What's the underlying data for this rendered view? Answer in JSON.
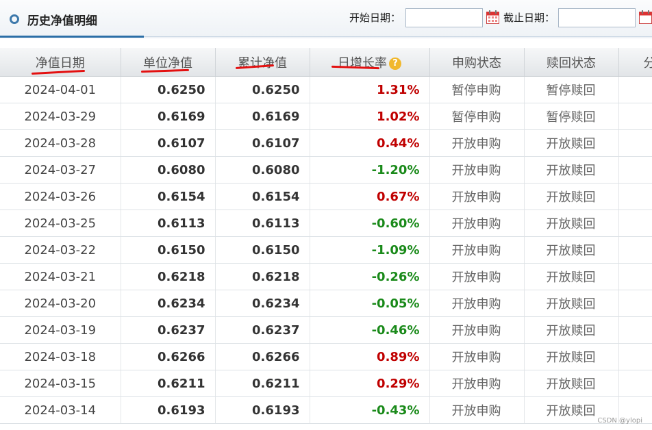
{
  "header": {
    "title": "历史净值明细",
    "start_label": "开始日期：",
    "end_label": "截止日期：",
    "start_value": "",
    "end_value": ""
  },
  "table": {
    "columns": [
      "净值日期",
      "单位净值",
      "累计净值",
      "日增长率",
      "申购状态",
      "赎回状态",
      "分"
    ],
    "rows": [
      {
        "date": "2024-04-01",
        "nav": "0.6250",
        "acc": "0.6250",
        "rate": "1.31%",
        "buy": "暂停申购",
        "sell": "暂停赎回"
      },
      {
        "date": "2024-03-29",
        "nav": "0.6169",
        "acc": "0.6169",
        "rate": "1.02%",
        "buy": "暂停申购",
        "sell": "暂停赎回"
      },
      {
        "date": "2024-03-28",
        "nav": "0.6107",
        "acc": "0.6107",
        "rate": "0.44%",
        "buy": "开放申购",
        "sell": "开放赎回"
      },
      {
        "date": "2024-03-27",
        "nav": "0.6080",
        "acc": "0.6080",
        "rate": "-1.20%",
        "buy": "开放申购",
        "sell": "开放赎回"
      },
      {
        "date": "2024-03-26",
        "nav": "0.6154",
        "acc": "0.6154",
        "rate": "0.67%",
        "buy": "开放申购",
        "sell": "开放赎回"
      },
      {
        "date": "2024-03-25",
        "nav": "0.6113",
        "acc": "0.6113",
        "rate": "-0.60%",
        "buy": "开放申购",
        "sell": "开放赎回"
      },
      {
        "date": "2024-03-22",
        "nav": "0.6150",
        "acc": "0.6150",
        "rate": "-1.09%",
        "buy": "开放申购",
        "sell": "开放赎回"
      },
      {
        "date": "2024-03-21",
        "nav": "0.6218",
        "acc": "0.6218",
        "rate": "-0.26%",
        "buy": "开放申购",
        "sell": "开放赎回"
      },
      {
        "date": "2024-03-20",
        "nav": "0.6234",
        "acc": "0.6234",
        "rate": "-0.05%",
        "buy": "开放申购",
        "sell": "开放赎回"
      },
      {
        "date": "2024-03-19",
        "nav": "0.6237",
        "acc": "0.6237",
        "rate": "-0.46%",
        "buy": "开放申购",
        "sell": "开放赎回"
      },
      {
        "date": "2024-03-18",
        "nav": "0.6266",
        "acc": "0.6266",
        "rate": "0.89%",
        "buy": "开放申购",
        "sell": "开放赎回"
      },
      {
        "date": "2024-03-15",
        "nav": "0.6211",
        "acc": "0.6211",
        "rate": "0.29%",
        "buy": "开放申购",
        "sell": "开放赎回"
      },
      {
        "date": "2024-03-14",
        "nav": "0.6193",
        "acc": "0.6193",
        "rate": "-0.43%",
        "buy": "开放申购",
        "sell": "开放赎回"
      }
    ]
  },
  "colors": {
    "up": "#c00000",
    "down": "#1a8a1a",
    "accent": "#2c6fa7",
    "underline": "#e31010"
  },
  "watermark": "CSDN @ylopi"
}
